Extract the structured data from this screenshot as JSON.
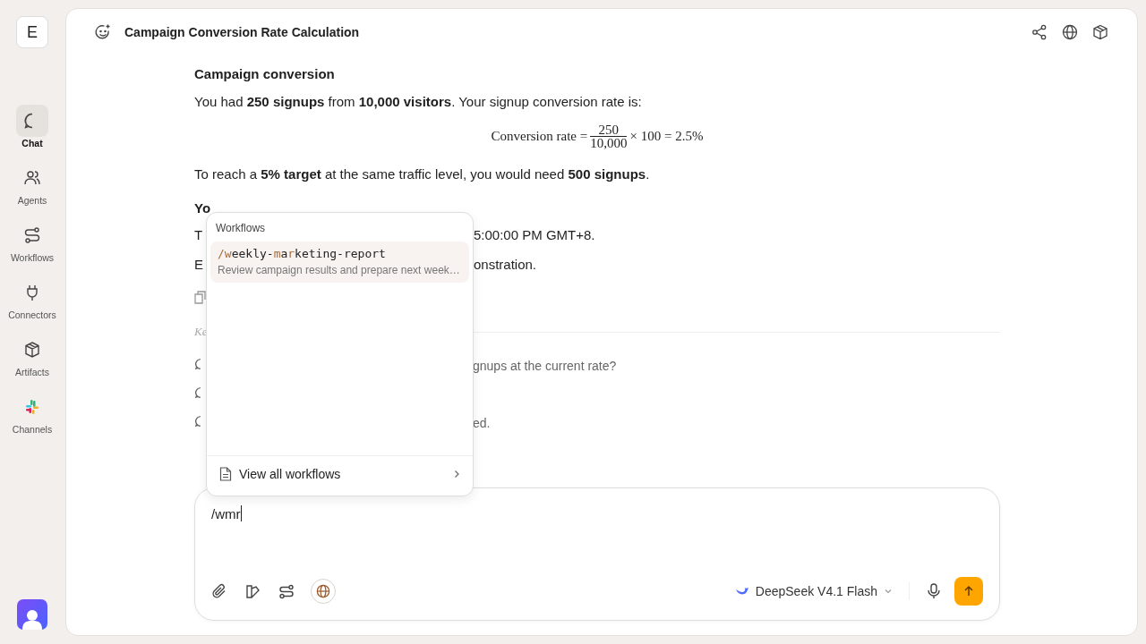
{
  "sidebar": {
    "workspace": "E",
    "items": [
      {
        "label": "Chat",
        "selected": true
      },
      {
        "label": "Agents",
        "selected": false
      },
      {
        "label": "Workflows",
        "selected": false
      },
      {
        "label": "Connectors",
        "selected": false
      },
      {
        "label": "Artifacts",
        "selected": false
      },
      {
        "label": "Channels",
        "selected": false
      }
    ]
  },
  "header": {
    "title": "Campaign Conversion Rate Calculation"
  },
  "message": {
    "heading": "Campaign conversion",
    "intro": "You had **250 signups** from **10,000 visitors**. Your signup conversion rate is:",
    "formula": {
      "lhs": "Conversion rate =",
      "numerator": "250",
      "denominator": "10,000",
      "rhs": "× 100 = 2.5%"
    },
    "target": "To reach a **5% target** at the same traffic level, you would need **500 signups**.",
    "partial_lines": [
      {
        "kind": "heading",
        "left": "Yo"
      },
      {
        "kind": "text",
        "left": "T",
        "right": "5:00:00 PM GMT+8."
      },
      {
        "kind": "text",
        "left": "E",
        "right": "onstration."
      }
    ]
  },
  "followups": {
    "label_visible": "Ke",
    "items": [
      {
        "kind": "text",
        "visible_text": "gnups at the current rate?"
      },
      {
        "kind": "icon_only"
      },
      {
        "kind": "text",
        "visible_text": "ed."
      }
    ]
  },
  "workflow_menu": {
    "title": "Workflows",
    "items": [
      {
        "selected": true,
        "command": [
          {
            "text": "/w",
            "match": true
          },
          {
            "text": "eekly-",
            "match": false
          },
          {
            "text": "m",
            "match": true
          },
          {
            "text": "a",
            "match": false
          },
          {
            "text": "r",
            "match": true
          },
          {
            "text": "keting-report",
            "match": false
          }
        ],
        "description": "Review campaign results and prepare next week…"
      }
    ],
    "footer": "View all workflows"
  },
  "composer": {
    "value": "/wmr",
    "web_search": {
      "on": true
    },
    "model": "DeepSeek V4.1 Flash"
  }
}
